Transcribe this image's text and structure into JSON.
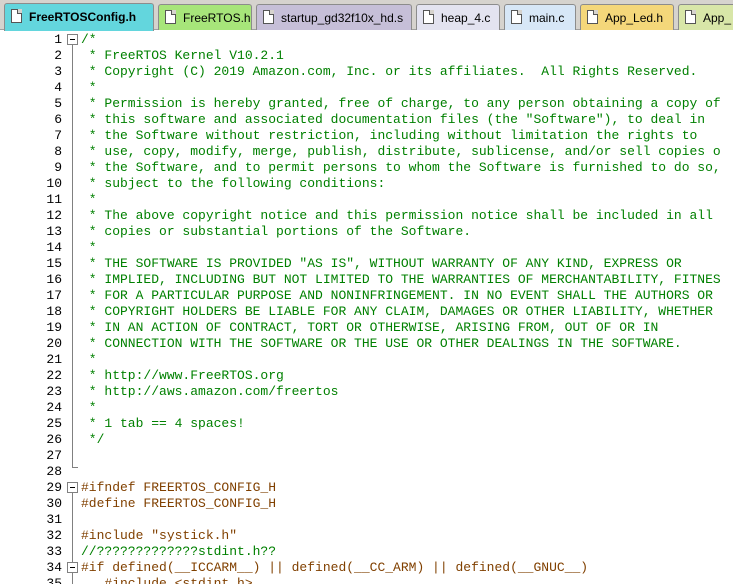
{
  "tabs": [
    {
      "label": "FreeRTOSConfig.h",
      "color": "#63d6dd",
      "active": true
    },
    {
      "label": "FreeRTOS.h",
      "color": "#a7e57a",
      "active": false
    },
    {
      "label": "startup_gd32f10x_hd.s",
      "color": "#c6bfd8",
      "active": false
    },
    {
      "label": "heap_4.c",
      "color": "#e3e3f0",
      "active": false
    },
    {
      "label": "main.c",
      "color": "#d7e7f7",
      "active": false
    },
    {
      "label": "App_Led.h",
      "color": "#f4d77a",
      "active": false
    },
    {
      "label": "App_",
      "color": "#d8e6a8",
      "active": false
    }
  ],
  "editor": {
    "lines": [
      {
        "n": "1",
        "text": "/*",
        "cls": "comment"
      },
      {
        "n": "2",
        "text": " * FreeRTOS Kernel V10.2.1",
        "cls": "comment"
      },
      {
        "n": "3",
        "text": " * Copyright (C) 2019 Amazon.com, Inc. or its affiliates.  All Rights Reserved.",
        "cls": "comment"
      },
      {
        "n": "4",
        "text": " *",
        "cls": "comment"
      },
      {
        "n": "5",
        "text": " * Permission is hereby granted, free of charge, to any person obtaining a copy of",
        "cls": "comment"
      },
      {
        "n": "6",
        "text": " * this software and associated documentation files (the \"Software\"), to deal in",
        "cls": "comment"
      },
      {
        "n": "7",
        "text": " * the Software without restriction, including without limitation the rights to",
        "cls": "comment"
      },
      {
        "n": "8",
        "text": " * use, copy, modify, merge, publish, distribute, sublicense, and/or sell copies o",
        "cls": "comment"
      },
      {
        "n": "9",
        "text": " * the Software, and to permit persons to whom the Software is furnished to do so,",
        "cls": "comment"
      },
      {
        "n": "10",
        "text": " * subject to the following conditions:",
        "cls": "comment"
      },
      {
        "n": "11",
        "text": " *",
        "cls": "comment"
      },
      {
        "n": "12",
        "text": " * The above copyright notice and this permission notice shall be included in all",
        "cls": "comment"
      },
      {
        "n": "13",
        "text": " * copies or substantial portions of the Software.",
        "cls": "comment"
      },
      {
        "n": "14",
        "text": " *",
        "cls": "comment"
      },
      {
        "n": "15",
        "text": " * THE SOFTWARE IS PROVIDED \"AS IS\", WITHOUT WARRANTY OF ANY KIND, EXPRESS OR",
        "cls": "comment"
      },
      {
        "n": "16",
        "text": " * IMPLIED, INCLUDING BUT NOT LIMITED TO THE WARRANTIES OF MERCHANTABILITY, FITNES",
        "cls": "comment"
      },
      {
        "n": "17",
        "text": " * FOR A PARTICULAR PURPOSE AND NONINFRINGEMENT. IN NO EVENT SHALL THE AUTHORS OR",
        "cls": "comment"
      },
      {
        "n": "18",
        "text": " * COPYRIGHT HOLDERS BE LIABLE FOR ANY CLAIM, DAMAGES OR OTHER LIABILITY, WHETHER",
        "cls": "comment"
      },
      {
        "n": "19",
        "text": " * IN AN ACTION OF CONTRACT, TORT OR OTHERWISE, ARISING FROM, OUT OF OR IN",
        "cls": "comment"
      },
      {
        "n": "20",
        "text": " * CONNECTION WITH THE SOFTWARE OR THE USE OR OTHER DEALINGS IN THE SOFTWARE.",
        "cls": "comment"
      },
      {
        "n": "21",
        "text": " *",
        "cls": "comment"
      },
      {
        "n": "22",
        "text": " * http://www.FreeRTOS.org",
        "cls": "comment"
      },
      {
        "n": "23",
        "text": " * http://aws.amazon.com/freertos",
        "cls": "comment"
      },
      {
        "n": "24",
        "text": " *",
        "cls": "comment"
      },
      {
        "n": "25",
        "text": " * 1 tab == 4 spaces!",
        "cls": "comment"
      },
      {
        "n": "26",
        "text": " */",
        "cls": "comment"
      },
      {
        "n": "27",
        "text": "",
        "cls": ""
      },
      {
        "n": "28",
        "text": "",
        "cls": ""
      },
      {
        "n": "29",
        "text": "#ifndef FREERTOS_CONFIG_H",
        "cls": "pp"
      },
      {
        "n": "30",
        "text": "#define FREERTOS_CONFIG_H",
        "cls": "pp"
      },
      {
        "n": "31",
        "text": "",
        "cls": ""
      },
      {
        "n": "32",
        "text": "#include \"systick.h\"",
        "cls": "inc"
      },
      {
        "n": "33",
        "text": "//?????????????stdint.h??",
        "cls": "comment"
      },
      {
        "n": "34",
        "text": "#if defined(__ICCARM__) || defined(__CC_ARM) || defined(__GNUC__)",
        "cls": "pp"
      },
      {
        "n": "35",
        "text": "   #include <stdint.h>",
        "cls": "inc"
      }
    ]
  }
}
